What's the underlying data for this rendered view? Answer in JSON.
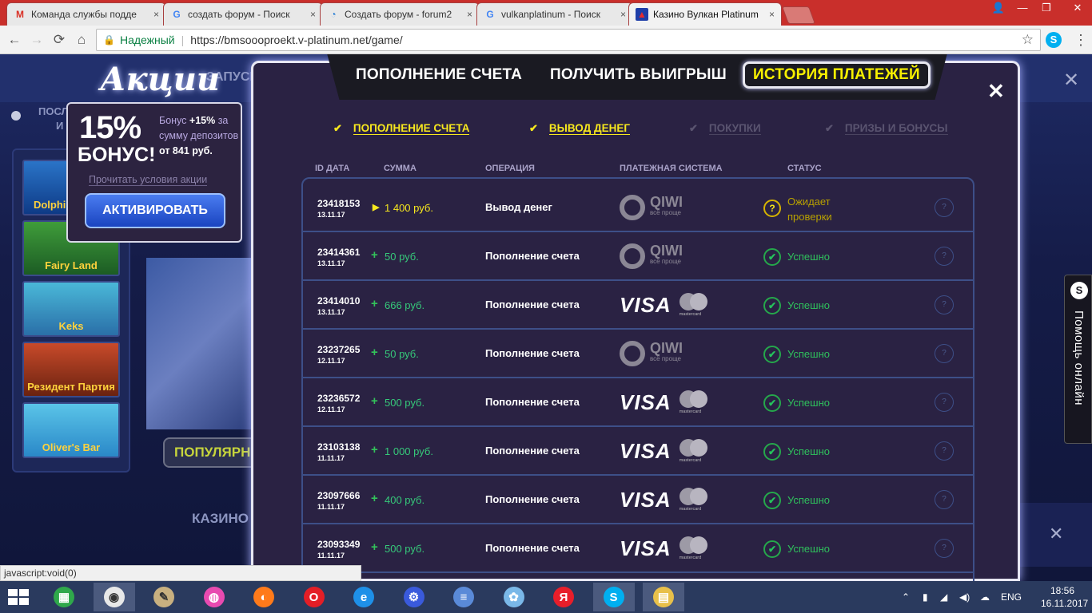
{
  "browser": {
    "tabs": [
      {
        "title": "Команда службы подде",
        "icon": "gmail-icon",
        "active": false
      },
      {
        "title": "создать форум - Поиск",
        "icon": "google-icon",
        "active": false
      },
      {
        "title": "Создать форум - forum2",
        "icon": "forum-icon",
        "active": false
      },
      {
        "title": "vulkanplatinum - Поиск",
        "icon": "google-icon",
        "active": false
      },
      {
        "title": "Казино Вулкан Platinum",
        "icon": "vulkan-icon",
        "active": true
      }
    ],
    "tab_close": "×",
    "window_controls": {
      "user": "👤",
      "minimize": "—",
      "restore": "❐",
      "close": "✕"
    },
    "nav": {
      "back": "←",
      "forward": "→",
      "reload": "⟳",
      "home": "⌂"
    },
    "address": {
      "secure_label": "Надежный",
      "separator": "|",
      "url": "https://bmsoooproekt.v-platinum.net/game/"
    },
    "skype_ext": "S",
    "menu": "⋮",
    "status_url": "javascript:void(0)"
  },
  "background": {
    "logo": "Акции",
    "partial_text_top": "ЗАПУСКА",
    "sidebar_heading": "ПОСЛ",
    "sidebar_heading2": "И",
    "popular_label": "ПОПУЛЯРН",
    "casino_label": "КАЗИНО",
    "close_icon": "✕",
    "games": [
      "Dolphin's Pearl",
      "Fairy Land",
      "Keks",
      "Резидент Партия",
      "Oliver's Bar"
    ]
  },
  "promo": {
    "percent": "15%",
    "bonus": "БОНУС!",
    "text_prefix": "Бонус ",
    "text_bonus": "+15%",
    "text_mid": " за сумму депозитов ",
    "text_from": "от 841 руб.",
    "terms_link": "Прочитать условия акции",
    "activate_button": "АКТИВИРОВАТЬ"
  },
  "modal": {
    "tabs": [
      {
        "label": "ПОПОЛНЕНИЕ СЧЕТА",
        "active": false
      },
      {
        "label": "ПОЛУЧИТЬ ВЫИГРЫШ",
        "active": false
      },
      {
        "label": "ИСТОРИЯ ПЛАТЕЖЕЙ",
        "active": true
      }
    ],
    "close": "✕",
    "filters": [
      {
        "label": "ПОПОЛНЕНИЕ СЧЕТА",
        "checked": true
      },
      {
        "label": "ВЫВОД ДЕНЕГ",
        "checked": true
      },
      {
        "label": "ПОКУПКИ",
        "checked": false
      },
      {
        "label": "ПРИЗЫ И БОНУСЫ",
        "checked": false
      }
    ],
    "check_glyph": "✔",
    "columns": {
      "id_date": "ID ДАТА",
      "amount": "СУММА",
      "operation": "ОПЕРАЦИЯ",
      "payment_system": "ПЛАТЕЖНАЯ СИСТЕМА",
      "status": "СТАТУС"
    },
    "rows": [
      {
        "id": "23418153",
        "date": "13.11.17",
        "sign": "▶",
        "amount": "1 400 руб.",
        "operation": "Вывод денег",
        "system": "qiwi",
        "status": "Ожидает проверки",
        "pending": true
      },
      {
        "id": "23414361",
        "date": "13.11.17",
        "sign": "+",
        "amount": "50 руб.",
        "operation": "Пополнение счета",
        "system": "qiwi",
        "status": "Успешно",
        "pending": false
      },
      {
        "id": "23414010",
        "date": "13.11.17",
        "sign": "+",
        "amount": "666 руб.",
        "operation": "Пополнение счета",
        "system": "visa",
        "status": "Успешно",
        "pending": false
      },
      {
        "id": "23237265",
        "date": "12.11.17",
        "sign": "+",
        "amount": "50 руб.",
        "operation": "Пополнение счета",
        "system": "qiwi",
        "status": "Успешно",
        "pending": false
      },
      {
        "id": "23236572",
        "date": "12.11.17",
        "sign": "+",
        "amount": "500 руб.",
        "operation": "Пополнение счета",
        "system": "visa",
        "status": "Успешно",
        "pending": false
      },
      {
        "id": "23103138",
        "date": "11.11.17",
        "sign": "+",
        "amount": "1 000 руб.",
        "operation": "Пополнение счета",
        "system": "visa",
        "status": "Успешно",
        "pending": false
      },
      {
        "id": "23097666",
        "date": "11.11.17",
        "sign": "+",
        "amount": "400 руб.",
        "operation": "Пополнение счета",
        "system": "visa",
        "status": "Успешно",
        "pending": false
      },
      {
        "id": "23093349",
        "date": "11.11.17",
        "sign": "+",
        "amount": "500 руб.",
        "operation": "Пополнение счета",
        "system": "visa",
        "status": "Успешно",
        "pending": false
      }
    ],
    "qiwi_name": "QIWI",
    "qiwi_sub": "всё проще",
    "visa_name": "VISA",
    "mastercard_name": "mastercard",
    "help_glyph": "?",
    "ok_glyph": "✔",
    "pending_glyph": "?"
  },
  "help_widget": {
    "icon": "S",
    "label": "Помощь онлайн"
  },
  "taskbar": {
    "apps": [
      "store-icon",
      "chrome-icon",
      "notepad-icon",
      "paint-icon",
      "firefox-icon",
      "opera-icon",
      "ie-icon",
      "settings-icon",
      "network-icon",
      "paint-brush-icon",
      "yandex-icon",
      "skype-icon",
      "explorer-icon"
    ],
    "tray_up": "⌃",
    "language": "ENG",
    "time": "18:56",
    "date": "16.11.2017"
  }
}
